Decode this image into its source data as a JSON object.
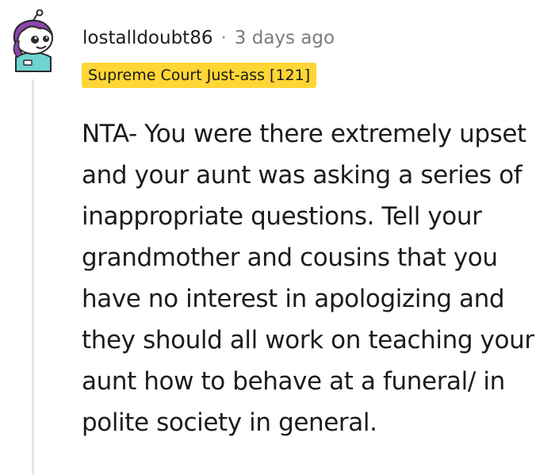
{
  "comment": {
    "username": "lostalldoubt86",
    "separator": "·",
    "timestamp": "3 days ago",
    "flair": "Supreme Court Just-ass [121]",
    "body": "NTA- You were there extremely upset and your aunt was asking a series of inappropriate questions. Tell your grandmother and cousins that you have no interest in apologizing and they should all work on teaching your aunt how to behave at a funeral/ in polite society in general.",
    "avatar_icon": "snoo-avatar-icon"
  },
  "colors": {
    "flair_background": "#ffd635",
    "avatar_purple": "#8e44ad",
    "thread_line": "#e6e7e8",
    "meta_text": "#7c7c7c"
  }
}
